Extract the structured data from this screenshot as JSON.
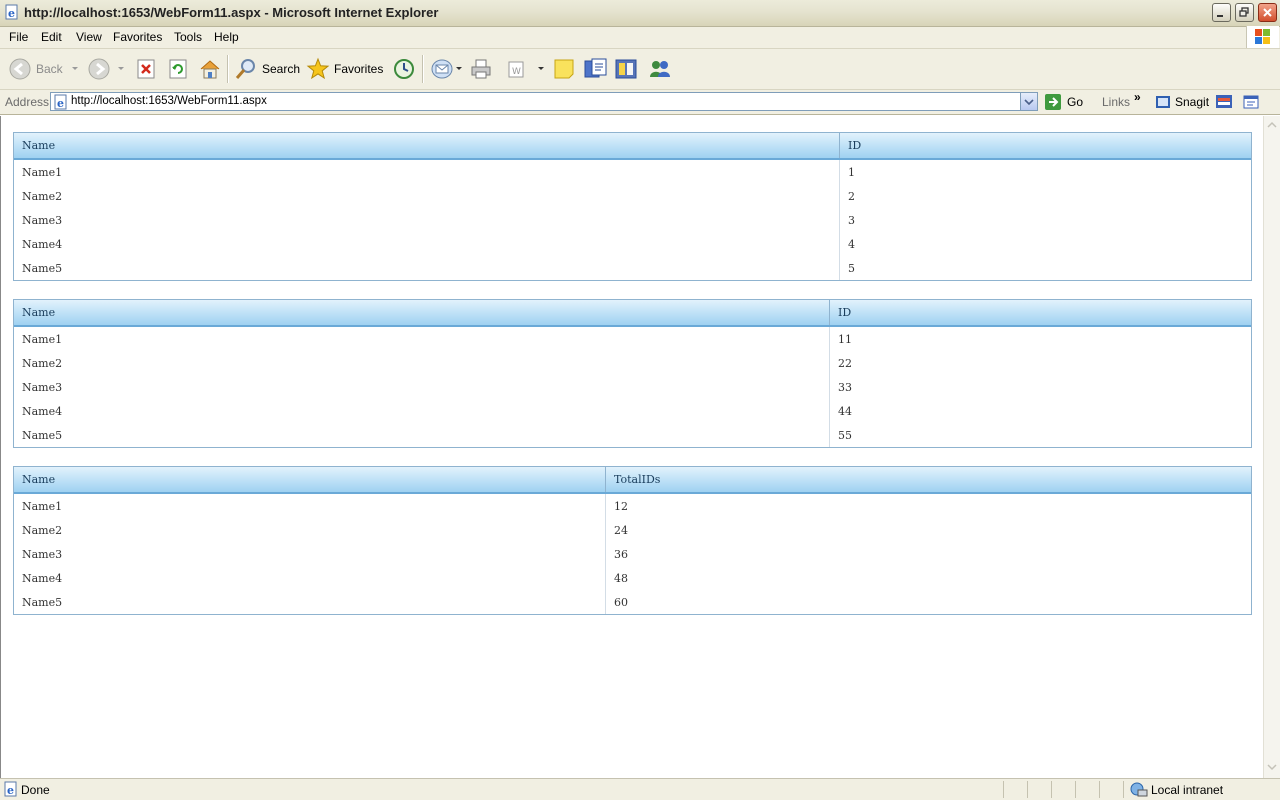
{
  "window": {
    "title": "http://localhost:1653/WebForm11.aspx - Microsoft Internet Explorer"
  },
  "menu": [
    "File",
    "Edit",
    "View",
    "Favorites",
    "Tools",
    "Help"
  ],
  "toolbar": {
    "back_label": "Back",
    "search_label": "Search",
    "favorites_label": "Favorites"
  },
  "address": {
    "label": "Address",
    "url": "http://localhost:1653/WebForm11.aspx",
    "go_label": "Go",
    "links_label": "Links",
    "snagit_label": "Snagit"
  },
  "grids": [
    {
      "headers": [
        "Name",
        "ID"
      ],
      "rows": [
        [
          "Name1",
          "1"
        ],
        [
          "Name2",
          "2"
        ],
        [
          "Name3",
          "3"
        ],
        [
          "Name4",
          "4"
        ],
        [
          "Name5",
          "5"
        ]
      ]
    },
    {
      "headers": [
        "Name",
        "ID"
      ],
      "rows": [
        [
          "Name1",
          "11"
        ],
        [
          "Name2",
          "22"
        ],
        [
          "Name3",
          "33"
        ],
        [
          "Name4",
          "44"
        ],
        [
          "Name5",
          "55"
        ]
      ]
    },
    {
      "headers": [
        "Name",
        "TotalIDs"
      ],
      "rows": [
        [
          "Name1",
          "12"
        ],
        [
          "Name2",
          "24"
        ],
        [
          "Name3",
          "36"
        ],
        [
          "Name4",
          "48"
        ],
        [
          "Name5",
          "60"
        ]
      ]
    }
  ],
  "status": {
    "text": "Done",
    "zone": "Local intranet"
  },
  "colors": {
    "header_gradient_top": "#e2f2fc",
    "header_gradient_bottom": "#9fd1f1",
    "grid_border": "#8fb3cf"
  }
}
